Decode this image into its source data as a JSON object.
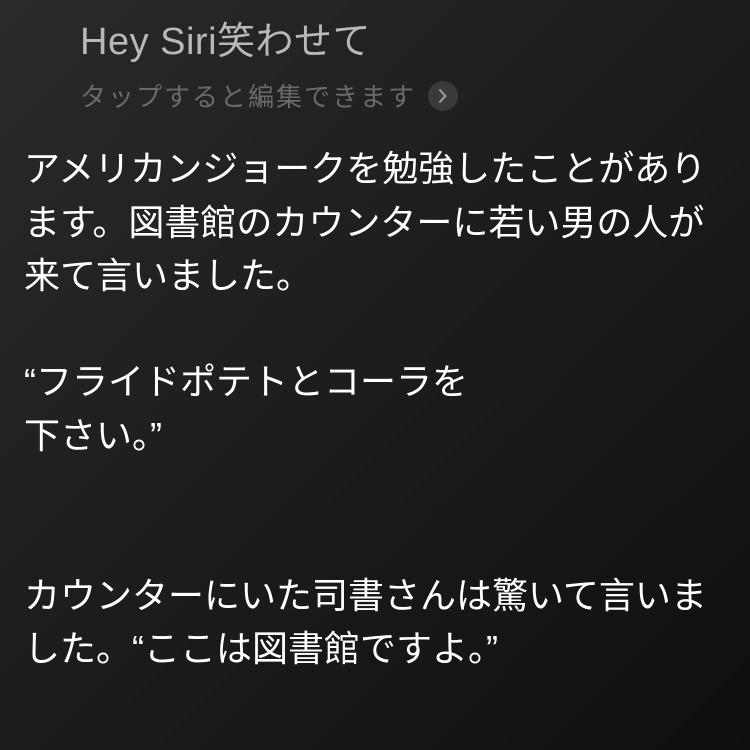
{
  "header": {
    "user_query": "Hey Siri笑わせて",
    "edit_hint": "タップすると編集できます"
  },
  "response": {
    "text": "アメリカンジョークを勉強したことがあります。図書館のカウンターに若い男の人が来て言いました。\n\n“フライドポテトとコーラを\n下さい。”\n\n\nカウンターにいた司書さんは驚いて言いました。“ここは図書館ですよ。”"
  }
}
